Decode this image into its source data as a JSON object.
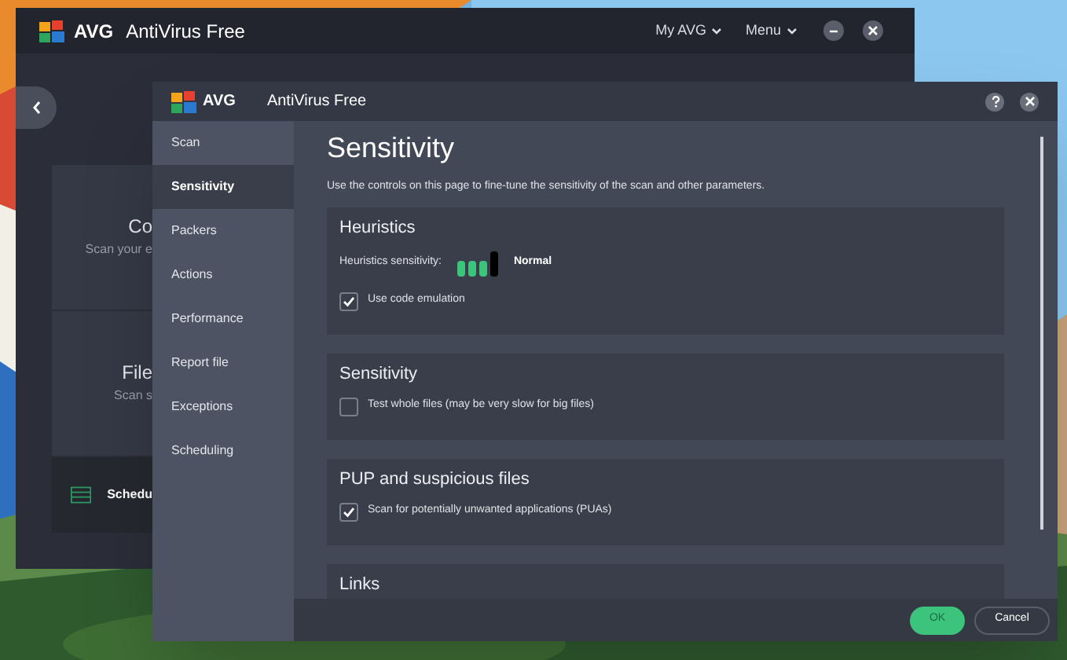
{
  "back_window": {
    "logo": "AVG",
    "title": "AntiVirus Free",
    "menu": [
      {
        "label": "My AVG"
      },
      {
        "label": "Menu"
      }
    ],
    "cards": [
      {
        "title": "Co",
        "subtitle": "Scan your e"
      },
      {
        "title": "File",
        "subtitle": "Scan s"
      }
    ],
    "footer": {
      "label": "Schedu"
    }
  },
  "dialog": {
    "logo": "AVG",
    "title": "AntiVirus Free",
    "sidebar": [
      {
        "label": "Scan",
        "selected": false
      },
      {
        "label": "Sensitivity",
        "selected": true
      },
      {
        "label": "Packers",
        "selected": false
      },
      {
        "label": "Actions",
        "selected": false
      },
      {
        "label": "Performance",
        "selected": false
      },
      {
        "label": "Report file",
        "selected": false
      },
      {
        "label": "Exceptions",
        "selected": false
      },
      {
        "label": "Scheduling",
        "selected": false
      }
    ],
    "heading": "Sensitivity",
    "description": "Use the controls on this page to fine-tune the sensitivity of the scan and other parameters.",
    "sections": [
      {
        "title": "Heuristics",
        "rows": [
          {
            "kind": "meter",
            "label": "Heuristics sensitivity:",
            "level": 0.75,
            "reading": "Normal"
          },
          {
            "kind": "checkbox",
            "label": "Use code emulation",
            "checked": true
          }
        ]
      },
      {
        "title": "Sensitivity",
        "rows": [
          {
            "kind": "checkbox",
            "label": "Test whole files (may be very slow for big files)",
            "checked": false
          }
        ]
      },
      {
        "title": "PUP and suspicious files",
        "rows": [
          {
            "kind": "checkbox",
            "label": "Scan for potentially unwanted applications (PUAs)",
            "checked": true
          }
        ]
      },
      {
        "title": "Links"
      }
    ],
    "buttons": [
      {
        "label": "OK",
        "kind": "primary"
      },
      {
        "label": "Cancel",
        "kind": "secondary"
      }
    ]
  }
}
